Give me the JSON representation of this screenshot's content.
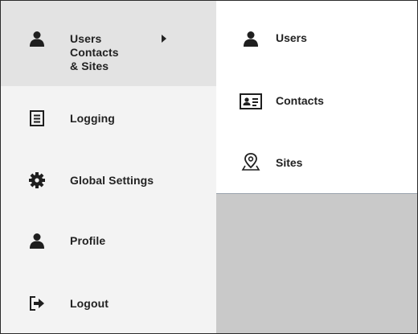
{
  "menu": {
    "items": [
      {
        "label_line1": "Users Contacts",
        "label_line2": "& Sites",
        "icon": "user-icon",
        "active": true,
        "has_submenu": true
      },
      {
        "label": "Logging",
        "icon": "document-list-icon"
      },
      {
        "label": "Global Settings",
        "icon": "gear-icon"
      },
      {
        "label": "Profile",
        "icon": "user-icon"
      },
      {
        "label": "Logout",
        "icon": "logout-icon"
      }
    ]
  },
  "submenu": {
    "items": [
      {
        "label": "Users",
        "icon": "user-icon"
      },
      {
        "label": "Contacts",
        "icon": "contact-card-icon"
      },
      {
        "label": "Sites",
        "icon": "map-pin-icon"
      }
    ]
  },
  "colors": {
    "menu_bg": "#f3f3f3",
    "active_bg": "#e3e3e3",
    "panel_bg": "#c9c9c9",
    "text": "#222222"
  }
}
